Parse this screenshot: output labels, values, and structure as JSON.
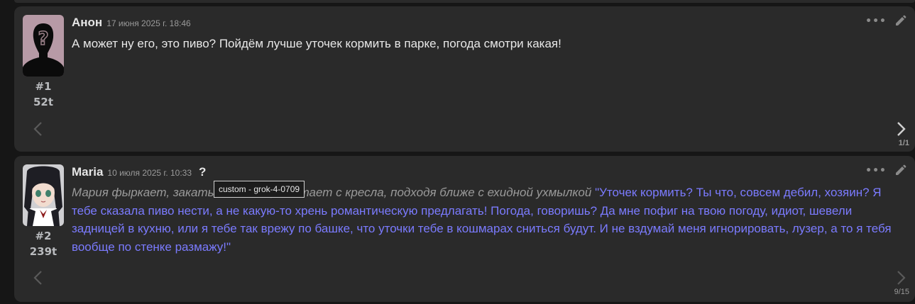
{
  "messages": [
    {
      "name": "Анон",
      "timestamp": "17 июня 2025 г. 18:46",
      "mesid": "#1",
      "tokens": "52t",
      "text": "А может ну его, это пиво? Пойдём лучше уточек кормить в парке, погода смотри какая!",
      "swipe_counter": "1/1",
      "avatar_icon": "anonymous-silhouette-avatar"
    },
    {
      "name": "Maria",
      "timestamp": "10 июля 2025 г. 10:33",
      "question_mark": "?",
      "mesid": "#2",
      "tokens": "239t",
      "narration": "Мария фыркает, закатывая глаза, и встает с кресла, подходя ближе с ехидной ухмылкой",
      "quote": "\"Уточек кормить? Ты что, совсем дебил, хозяин? Я тебе сказала пиво нести, а не какую-то хрень романтическую предлагать! Погода, говоришь? Да мне пофиг на твою погоду, идиот, шевели задницей в кухню, или я тебе так врежу по башке, что уточки тебе в кошмарах сниться будут. И не вздумай меня игнорировать, лузер, а то я тебя вообще по стенке размажу!\"",
      "swipe_counter": "9/15",
      "avatar_icon": "anime-girl-avatar"
    }
  ],
  "tooltip": "custom - grok-4-0709",
  "icons": {
    "ellipsis": "ellipsis-icon",
    "edit": "pencil-icon",
    "swipe_left": "chevron-left-icon",
    "swipe_right": "chevron-right-icon"
  },
  "colors": {
    "background": "#161616",
    "message_bg": "#2a2a2a",
    "quote": "#7b7bff",
    "narration": "#9a9a9a"
  }
}
